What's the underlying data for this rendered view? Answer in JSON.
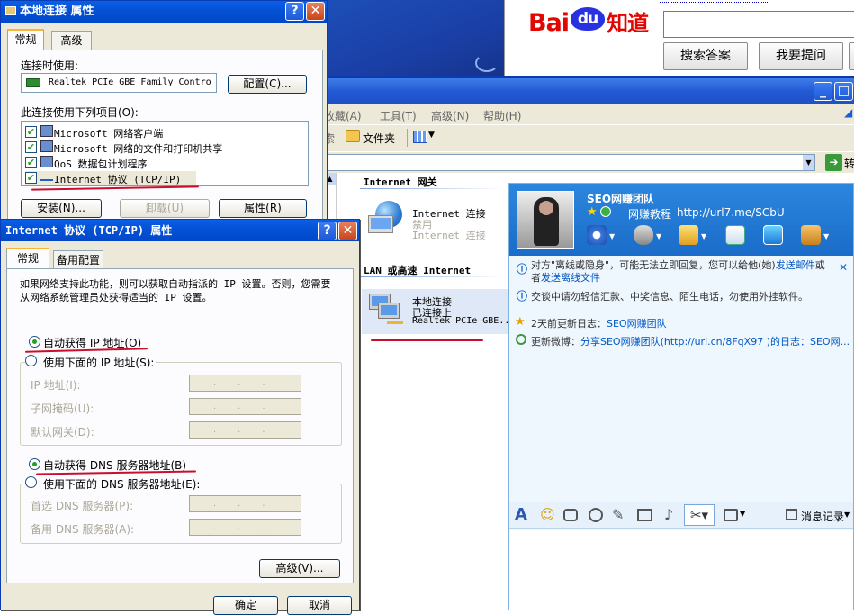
{
  "baidu": {
    "logo_text": "Bai",
    "logo_paw": "du",
    "logo_cn": "知道",
    "search_btn": "搜索答案",
    "ask_btn": "我要提问"
  },
  "explorer": {
    "menu": [
      "收藏(A)",
      "工具(T)",
      "高级(N)",
      "帮助(H)"
    ],
    "toolbar_folder": "文件夹",
    "go_label": "转",
    "section_internet": "Internet 网关",
    "section_lan": "LAN 或高速 Internet",
    "gw_name": "Internet 连接",
    "gw_status1": "禁用",
    "gw_status2": "Internet 连接",
    "lan_name": "本地连接",
    "lan_status": "已连接上",
    "lan_device": "Realtek PCIe GBE..."
  },
  "props": {
    "title": "本地连接 属性",
    "tab_general": "常规",
    "tab_advanced": "高级",
    "connect_using": "连接时使用:",
    "adapter": "Realtek PCIe GBE Family Contro",
    "config_btn": "配置(C)...",
    "items_label": "此连接使用下列项目(O):",
    "items": [
      "Microsoft 网络客户端",
      "Microsoft 网络的文件和打印机共享",
      "QoS 数据包计划程序",
      "Internet 协议 (TCP/IP)"
    ],
    "install_btn": "安装(N)...",
    "uninstall_btn": "卸载(U)",
    "properties_btn": "属性(R)"
  },
  "tcpip": {
    "title": "Internet 协议 (TCP/IP) 属性",
    "tab_general": "常规",
    "tab_alternate": "备用配置",
    "desc": "如果网络支持此功能，则可以获取自动指派的 IP 设置。否则，您需要从网络系统管理员处获得适当的 IP 设置。",
    "auto_ip": "自动获得 IP 地址(O)",
    "manual_ip": "使用下面的 IP 地址(S):",
    "ip_label": "IP 地址(I):",
    "mask_label": "子网掩码(U):",
    "gateway_label": "默认网关(D):",
    "auto_dns": "自动获得 DNS 服务器地址(B)",
    "manual_dns": "使用下面的 DNS 服务器地址(E):",
    "dns1_label": "首选 DNS 服务器(P):",
    "dns2_label": "备用 DNS 服务器(A):",
    "advanced_btn": "高级(V)...",
    "ok_btn": "确定",
    "cancel_btn": "取消",
    "ip_dots": "...",
    "selected_ip_mode": "auto",
    "selected_dns_mode": "auto"
  },
  "chat": {
    "name": "SEO网赚团队",
    "sign_prefix": "网赚教程",
    "sign_url": "http://url7.me/SCbU",
    "notice1_pre": "对方\"离线或隐身\"，可能无法立即回复，您可以给他(她)",
    "notice1_link": "发送邮件",
    "notice1_mid": "或者",
    "notice1_link2": "发送离线文件",
    "notice2": "交谈中请勿轻信汇款、中奖信息、陌生电话，勿使用外挂软件。",
    "update_pre": "2天前更新日志：",
    "update_link": "SEO网赚团队",
    "weibo_pre": "更新微博：",
    "weibo_link": "分享SEO网赚团队(http://url.cn/8FqX97 )的日志：SEO网...",
    "history_btn": "消息记录",
    "accent": "#1a6cc8"
  }
}
